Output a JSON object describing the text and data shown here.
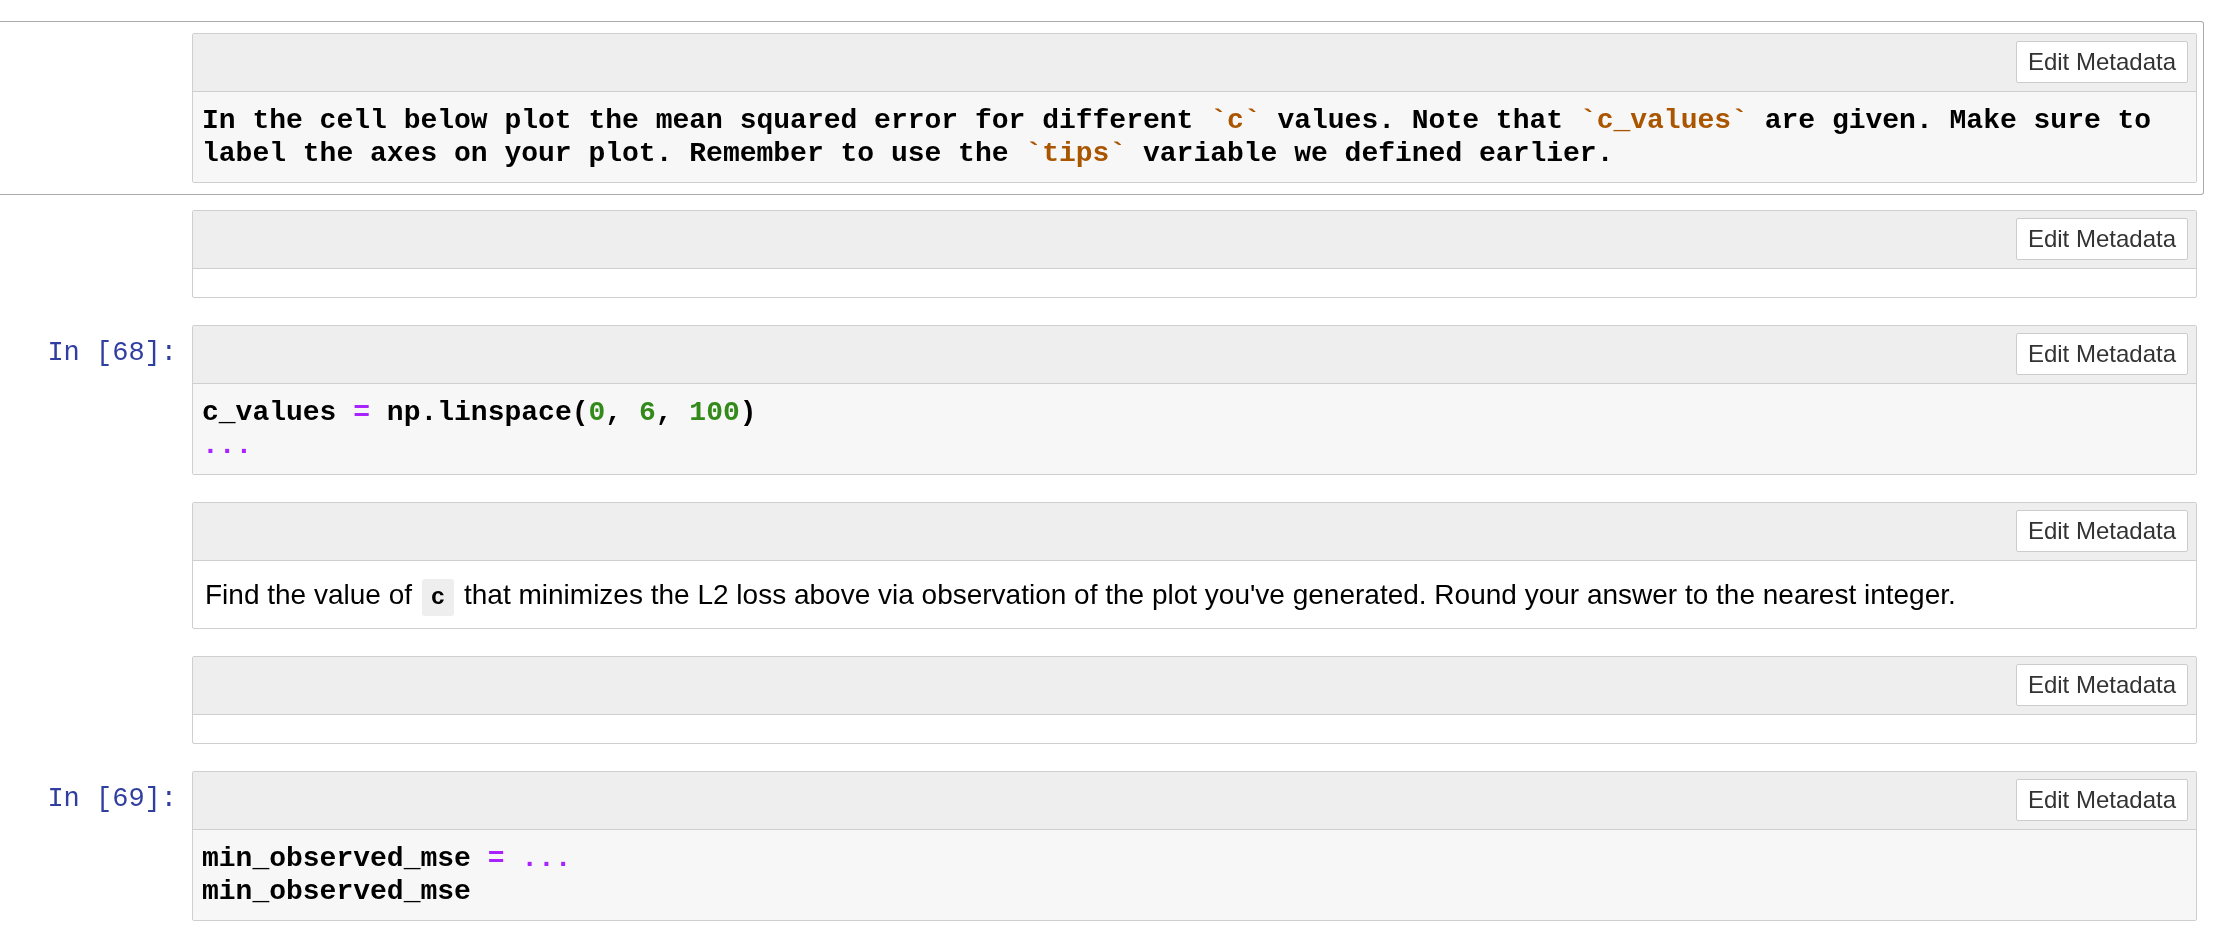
{
  "cells": [
    {
      "kind": "markdown_source",
      "selected": true,
      "button": "Edit Metadata",
      "segments": [
        {
          "text": "In the cell below plot the mean squared error for different ",
          "kind": "plain"
        },
        {
          "text": "`c`",
          "kind": "code"
        },
        {
          "text": " values. Note that ",
          "kind": "plain"
        },
        {
          "text": "`c_values`",
          "kind": "code"
        },
        {
          "text": " are given. Make sure to label the axes on your plot. Remember to use the ",
          "kind": "plain"
        },
        {
          "text": "`tips`",
          "kind": "code"
        },
        {
          "text": " variable we defined earlier.",
          "kind": "plain"
        }
      ]
    },
    {
      "kind": "empty",
      "selected": false,
      "button": "Edit Metadata"
    },
    {
      "kind": "code",
      "selected": false,
      "prompt": "In [68]:",
      "button": "Edit Metadata",
      "lines": [
        [
          {
            "text": "c_values ",
            "kind": "plain"
          },
          {
            "text": "=",
            "kind": "operator"
          },
          {
            "text": " np.linspace(",
            "kind": "plain"
          },
          {
            "text": "0",
            "kind": "number"
          },
          {
            "text": ", ",
            "kind": "plain"
          },
          {
            "text": "6",
            "kind": "number"
          },
          {
            "text": ", ",
            "kind": "plain"
          },
          {
            "text": "100",
            "kind": "number"
          },
          {
            "text": ")",
            "kind": "plain"
          }
        ],
        [
          {
            "text": "...",
            "kind": "operator"
          }
        ]
      ]
    },
    {
      "kind": "markdown",
      "selected": false,
      "button": "Edit Metadata",
      "segments": [
        {
          "text": "Find the value of ",
          "kind": "plain"
        },
        {
          "text": "c",
          "kind": "code"
        },
        {
          "text": " that minimizes the L2 loss above via observation of the plot you've generated. Round your answer to the nearest integer.",
          "kind": "plain"
        }
      ]
    },
    {
      "kind": "empty",
      "selected": false,
      "button": "Edit Metadata"
    },
    {
      "kind": "code",
      "selected": false,
      "prompt": "In [69]:",
      "button": "Edit Metadata",
      "lines": [
        [
          {
            "text": "min_observed_mse ",
            "kind": "plain"
          },
          {
            "text": "= ...",
            "kind": "operator"
          }
        ],
        [
          {
            "text": "min_observed_mse",
            "kind": "plain"
          }
        ]
      ]
    }
  ]
}
